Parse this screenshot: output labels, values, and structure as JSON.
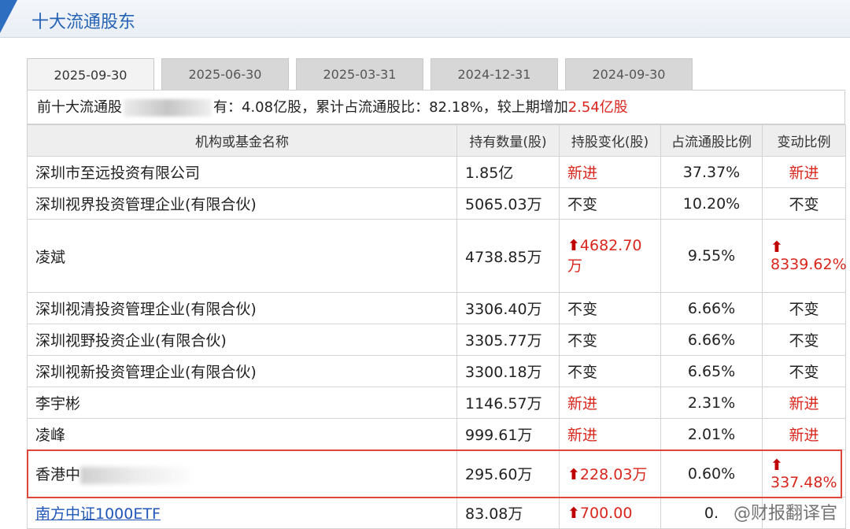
{
  "title": "十大流通股东",
  "tabs": [
    "2025-09-30",
    "2025-06-30",
    "2025-03-31",
    "2024-12-31",
    "2024-09-30"
  ],
  "summary": {
    "prefix": "前十大流通股",
    "suffix": "有：4.08亿股，累计占流通股比：82.18%，较上期增加",
    "increase": "2.54亿股"
  },
  "table": {
    "headers": [
      "机构或基金名称",
      "持有数量(股)",
      "持股变化(股)",
      "占流通股比例",
      "变动比例"
    ],
    "rows": [
      {
        "name": "深圳市至远投资有限公司",
        "qty": "1.85亿",
        "change": "新进",
        "pct": "37.37%",
        "ratio": "新进"
      },
      {
        "name": "深圳视界投资管理企业(有限合伙)",
        "qty": "5065.03万",
        "change": "不变",
        "pct": "10.20%",
        "ratio": "不变"
      },
      {
        "name": "凌斌",
        "qty": "4738.85万",
        "change": "4682.70万",
        "pct": "9.55%",
        "ratio": "8339.62%"
      },
      {
        "name": "深圳视清投资管理企业(有限合伙)",
        "qty": "3306.40万",
        "change": "不变",
        "pct": "6.66%",
        "ratio": "不变"
      },
      {
        "name": "深圳视野投资企业(有限合伙)",
        "qty": "3305.77万",
        "change": "不变",
        "pct": "6.66%",
        "ratio": "不变"
      },
      {
        "name": "深圳视新投资管理企业(有限合伙)",
        "qty": "3300.18万",
        "change": "不变",
        "pct": "6.65%",
        "ratio": "不变"
      },
      {
        "name": "李宇彬",
        "qty": "1146.57万",
        "change": "新进",
        "pct": "2.31%",
        "ratio": "新进"
      },
      {
        "name": "凌峰",
        "qty": "999.61万",
        "change": "新进",
        "pct": "2.01%",
        "ratio": "新进"
      },
      {
        "name": "香港中",
        "qty": "295.60万",
        "change": "228.03万",
        "pct": "0.60%",
        "ratio": "337.48%"
      },
      {
        "name": "南方中证1000ETF",
        "qty": "83.08万",
        "change": "700.00",
        "pct": "0.",
        "ratio": ""
      }
    ]
  },
  "watermark": "@财报翻译官",
  "colors": {
    "accent": "#2563b5",
    "red": "#d9261c",
    "highlight": "#e0453a"
  }
}
